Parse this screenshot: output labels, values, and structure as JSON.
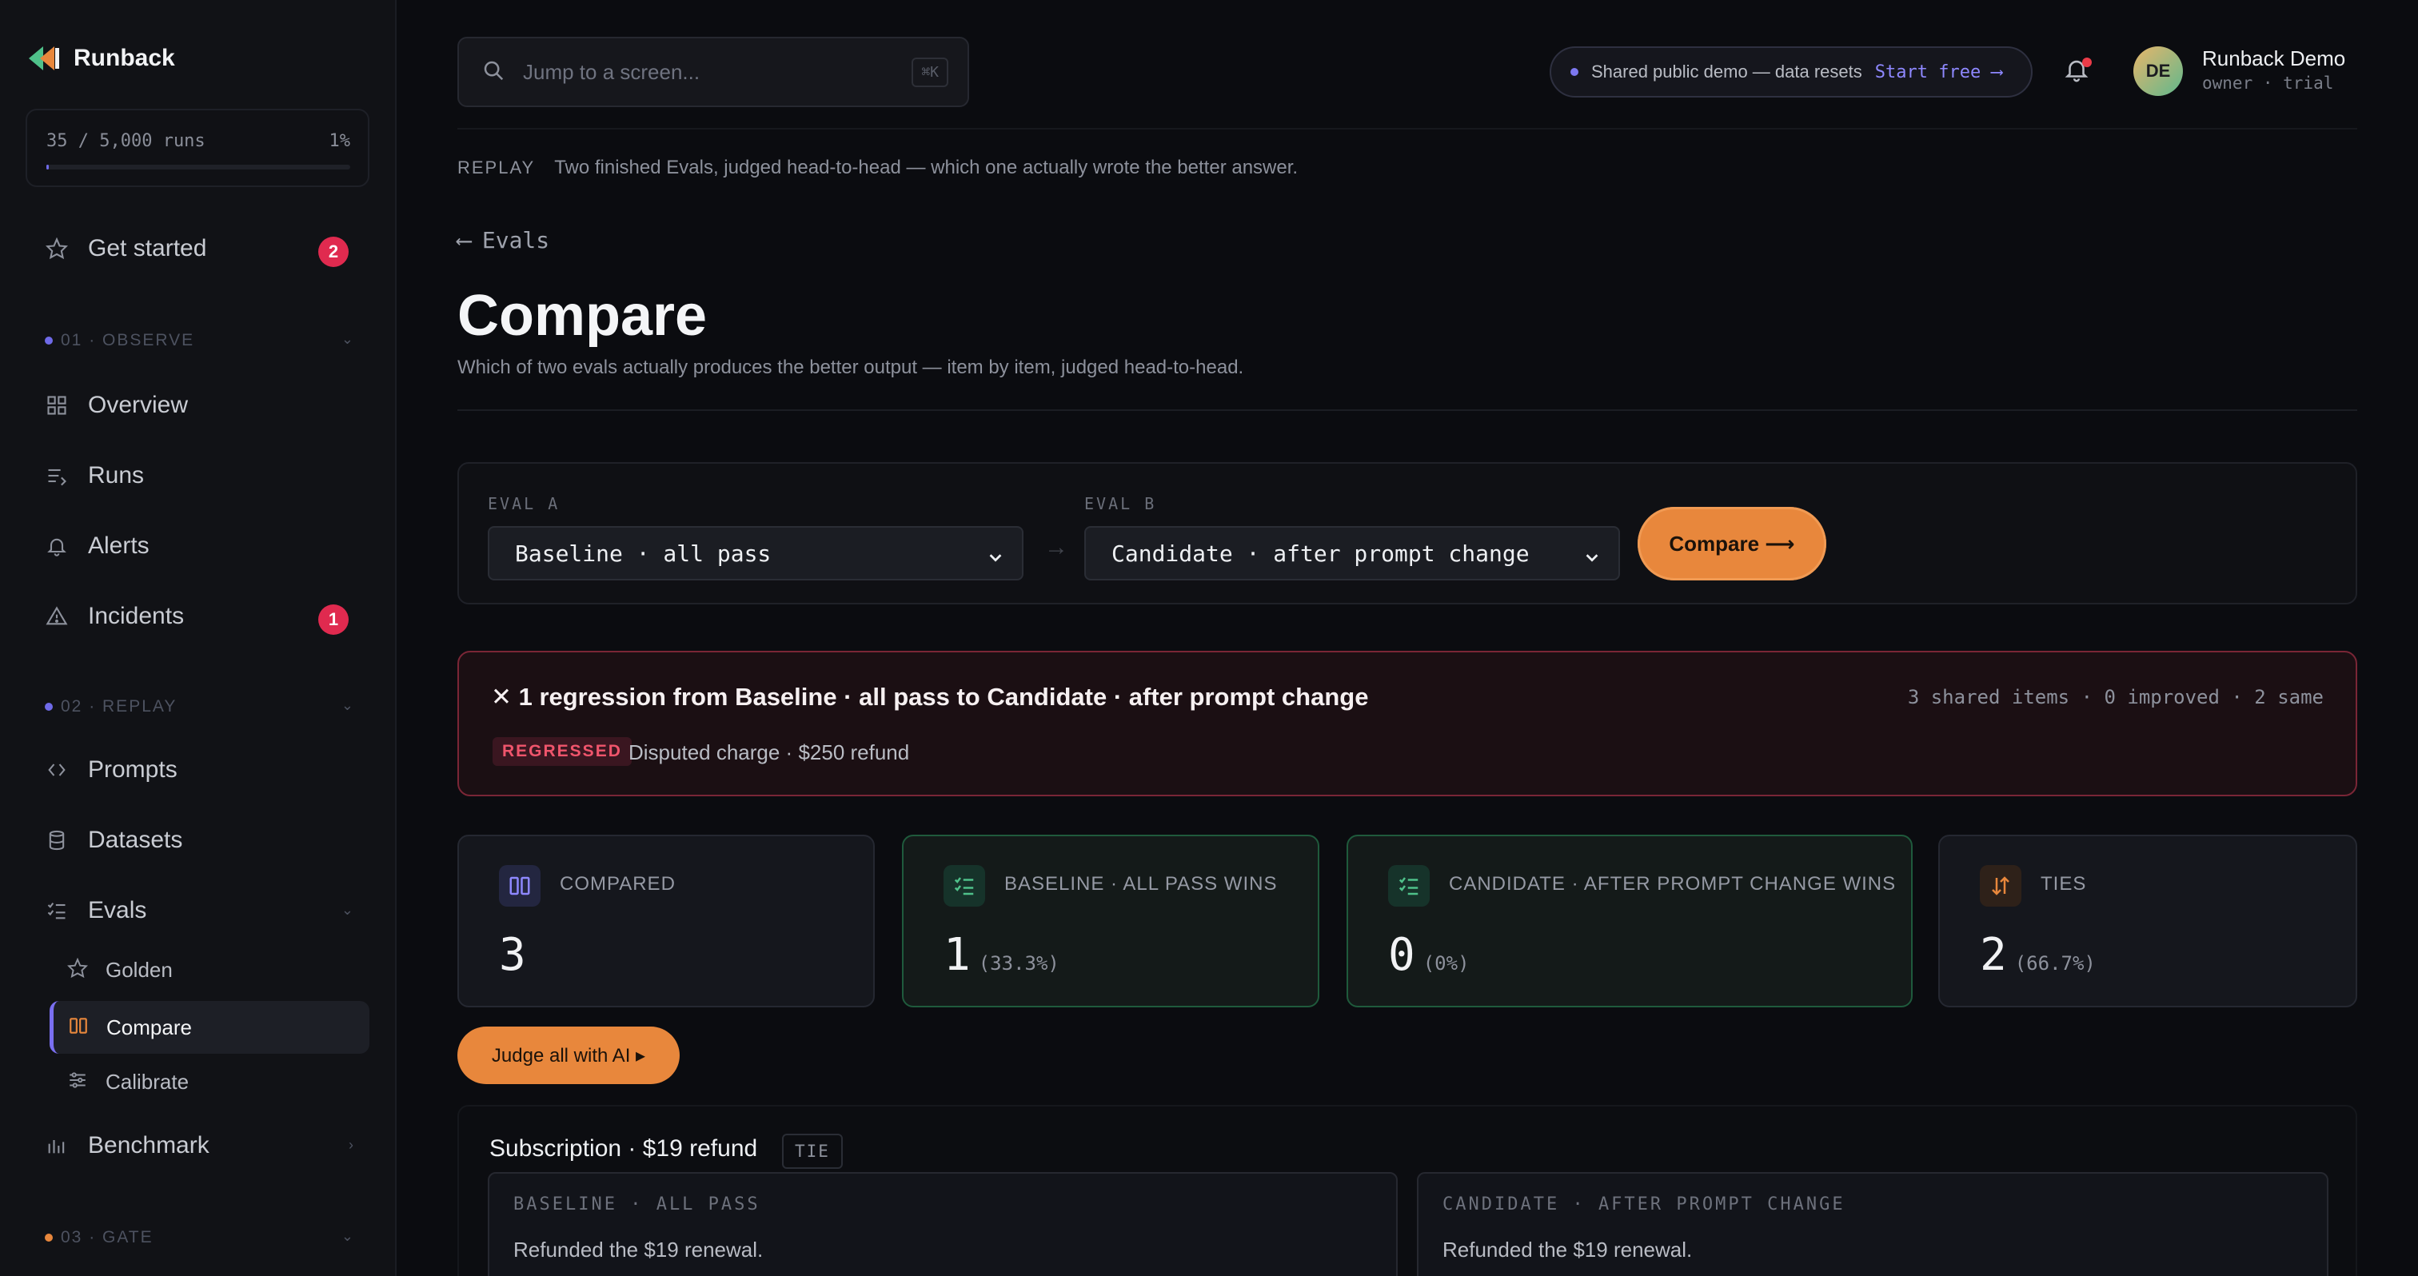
{
  "brand": {
    "name": "Runback"
  },
  "usage": {
    "label": "35 / 5,000 runs",
    "percent": "1%",
    "fraction": 0.007
  },
  "sidebar": {
    "get_started": {
      "label": "Get started",
      "badge": "2"
    },
    "sections": [
      {
        "label": "01 · OBSERVE",
        "color": "#6f6ae8"
      },
      {
        "label": "02 · REPLAY",
        "color": "#6f6ae8"
      },
      {
        "label": "03 · GATE",
        "color": "#e8873c"
      }
    ],
    "observe": [
      {
        "label": "Overview",
        "icon": "grid-icon"
      },
      {
        "label": "Runs",
        "icon": "list-icon"
      },
      {
        "label": "Alerts",
        "icon": "bell-icon"
      },
      {
        "label": "Incidents",
        "icon": "warning-icon",
        "badge": "1"
      }
    ],
    "replay": [
      {
        "label": "Prompts",
        "icon": "code-icon"
      },
      {
        "label": "Datasets",
        "icon": "database-icon"
      },
      {
        "label": "Evals",
        "icon": "checklist-icon"
      }
    ],
    "evals_sub": [
      {
        "label": "Golden",
        "icon": "star-icon"
      },
      {
        "label": "Compare",
        "icon": "columns-icon",
        "active": true
      },
      {
        "label": "Calibrate",
        "icon": "sliders-icon"
      }
    ],
    "benchmark": {
      "label": "Benchmark",
      "icon": "bar-chart-icon"
    }
  },
  "search": {
    "placeholder": "Jump to a screen...",
    "shortcut": "⌘K"
  },
  "demo_banner": {
    "text": "Shared public demo — data resets",
    "link": "Start free ⟶"
  },
  "user": {
    "initials": "DE",
    "name": "Runback Demo",
    "role": "owner · trial"
  },
  "replay_banner": {
    "tag": "REPLAY",
    "text": "Two finished Evals, judged head-to-head — which one actually wrote the better answer."
  },
  "page": {
    "back": "Evals",
    "title": "Compare",
    "subtitle": "Which of two evals actually produces the better output — item by item, judged head-to-head."
  },
  "picker": {
    "eval_a_label": "EVAL A",
    "eval_a_value": "Baseline · all pass",
    "eval_b_label": "EVAL B",
    "eval_b_value": "Candidate · after prompt change",
    "compare_button": "Compare ⟶"
  },
  "regression": {
    "title": "✕ 1 regression from Baseline · all pass to Candidate · after prompt change",
    "stats": "3 shared items · 0 improved · 2 same",
    "tag": "REGRESSED",
    "item": "Disputed charge · $250 refund"
  },
  "stats": [
    {
      "label": "COMPARED",
      "value": "3",
      "pct": "",
      "icon": "columns-icon"
    },
    {
      "label": "BASELINE · ALL PASS WINS",
      "value": "1",
      "pct": "(33.3%)",
      "icon": "checklist-icon"
    },
    {
      "label": "CANDIDATE · AFTER PROMPT CHANGE WINS",
      "value": "0",
      "pct": "(0%)",
      "icon": "checklist-icon"
    },
    {
      "label": "TIES",
      "value": "2",
      "pct": "(66.7%)",
      "icon": "sort-icon"
    }
  ],
  "judge_button": "Judge all with AI ▸",
  "item": {
    "title": "Subscription · $19 refund",
    "verdict": "TIE",
    "left_label": "BASELINE · ALL PASS",
    "left_text": "Refunded the $19 renewal.",
    "right_label": "CANDIDATE · AFTER PROMPT CHANGE",
    "right_text": "Refunded the $19 renewal."
  }
}
